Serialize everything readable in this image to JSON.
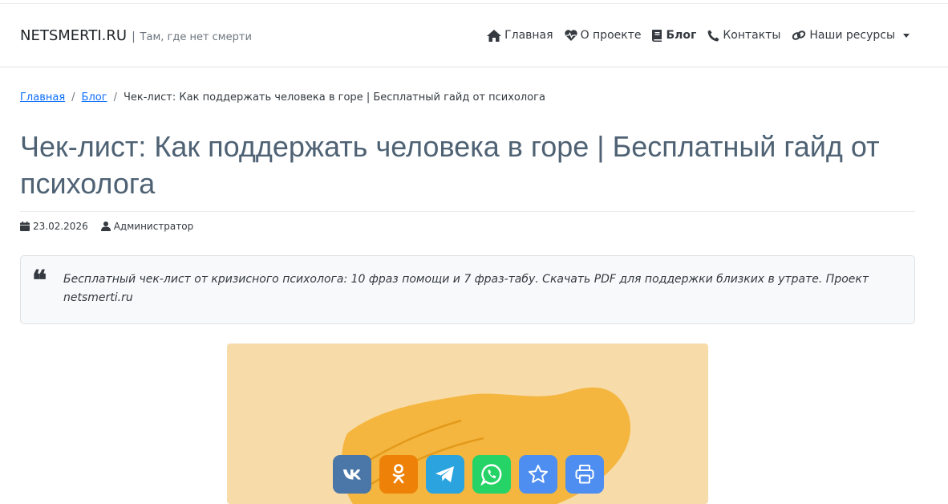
{
  "brand": {
    "name": "NETSMERTI.RU",
    "separator": "|",
    "tagline": "Там, где нет смерти"
  },
  "nav": {
    "items": [
      {
        "label": "Главная",
        "icon": "home-icon",
        "active": false
      },
      {
        "label": "О проекте",
        "icon": "heartbeat-icon",
        "active": false
      },
      {
        "label": "Блог",
        "icon": "book-icon",
        "active": true
      },
      {
        "label": "Контакты",
        "icon": "phone-icon",
        "active": false
      },
      {
        "label": "Наши ресурсы",
        "icon": "link-icon",
        "active": false,
        "dropdown": true
      }
    ]
  },
  "breadcrumb": {
    "home": "Главная",
    "blog": "Блог",
    "current": "Чек-лист: Как поддержать человека в горе | Бесплатный гайд от психолога",
    "separator": "/"
  },
  "article": {
    "title": "Чек-лист: Как поддержать человека в горе | Бесплатный гайд от психолога",
    "date": "23.02.2026",
    "author": "Администратор",
    "summary": "Бесплатный чек-лист от кризисного психолога: 10 фраз помощи и 7 фраз-табу. Скачать PDF для поддержки близких в утрате. Проект netsmerti.ru",
    "quote_mark": "❝"
  },
  "share": [
    {
      "name": "vk",
      "icon": "vk-icon",
      "color": "#4a76a8"
    },
    {
      "name": "odnoklassniki",
      "icon": "odnoklassniki-icon",
      "color": "#ee8208"
    },
    {
      "name": "telegram",
      "icon": "telegram-icon",
      "color": "#2aa3df"
    },
    {
      "name": "whatsapp",
      "icon": "whatsapp-icon",
      "color": "#25d366"
    },
    {
      "name": "bookmark",
      "icon": "star-icon",
      "color": "#4d8ef0"
    },
    {
      "name": "print",
      "icon": "printer-icon",
      "color": "#4d8ef0"
    }
  ],
  "colors": {
    "link": "#0d6efd",
    "title": "#4e6274",
    "hero_bg": "#f7dcaa",
    "hero_shape": "#f4b63f"
  }
}
